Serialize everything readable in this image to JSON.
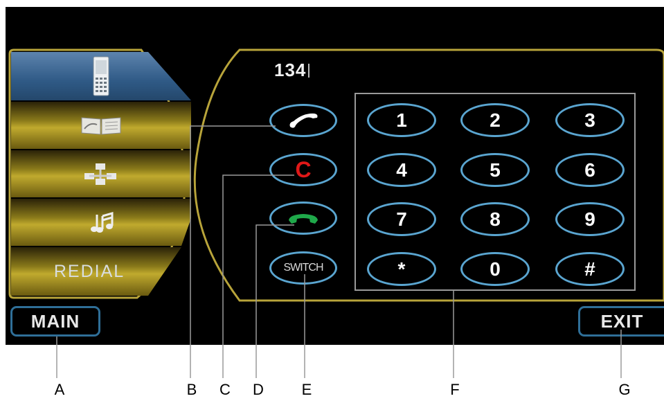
{
  "sidebar": {
    "items": [
      {
        "icon": "mobile-phone-icon"
      },
      {
        "icon": "phonebook-icon"
      },
      {
        "icon": "network-icon"
      },
      {
        "icon": "music-note-icon"
      },
      {
        "label": "REDIAL"
      }
    ]
  },
  "display": {
    "number": "134"
  },
  "function_buttons": {
    "send_icon": "handset-white-icon",
    "clear_label": "C",
    "accept_icon": "handset-green-icon",
    "switch_label": "SWITCH"
  },
  "keypad": {
    "keys": [
      "1",
      "2",
      "3",
      "4",
      "5",
      "6",
      "7",
      "8",
      "9",
      "*",
      "0",
      "#"
    ]
  },
  "nav": {
    "main_label": "MAIN",
    "exit_label": "EXIT"
  },
  "callouts": [
    "A",
    "B",
    "C",
    "D",
    "E",
    "F",
    "G"
  ],
  "colors": {
    "gold": "#c0aa2e",
    "key_border": "#5aa5d0",
    "clear_red": "#e01818",
    "accept_green": "#1fa84a",
    "sidebar_selected": "#2f5a86"
  }
}
